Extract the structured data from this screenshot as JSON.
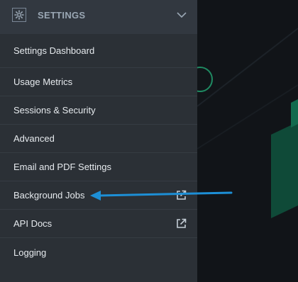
{
  "header": {
    "title": "SETTINGS",
    "icon": "gear-icon",
    "toggle_icon": "chevron-down-icon"
  },
  "menu": {
    "items": [
      {
        "label": "Settings Dashboard",
        "external": false
      },
      {
        "label": "Usage Metrics",
        "external": false
      },
      {
        "label": "Sessions & Security",
        "external": false
      },
      {
        "label": "Advanced",
        "external": false
      },
      {
        "label": "Email and PDF Settings",
        "external": false
      },
      {
        "label": "Background Jobs",
        "external": true
      },
      {
        "label": "API Docs",
        "external": true
      },
      {
        "label": "Logging",
        "external": false
      }
    ]
  },
  "colors": {
    "sidebar_bg": "#2b3036",
    "header_bg": "#323840",
    "annotation_arrow": "#1d8fd6",
    "accent_green": "#1f8a62"
  }
}
